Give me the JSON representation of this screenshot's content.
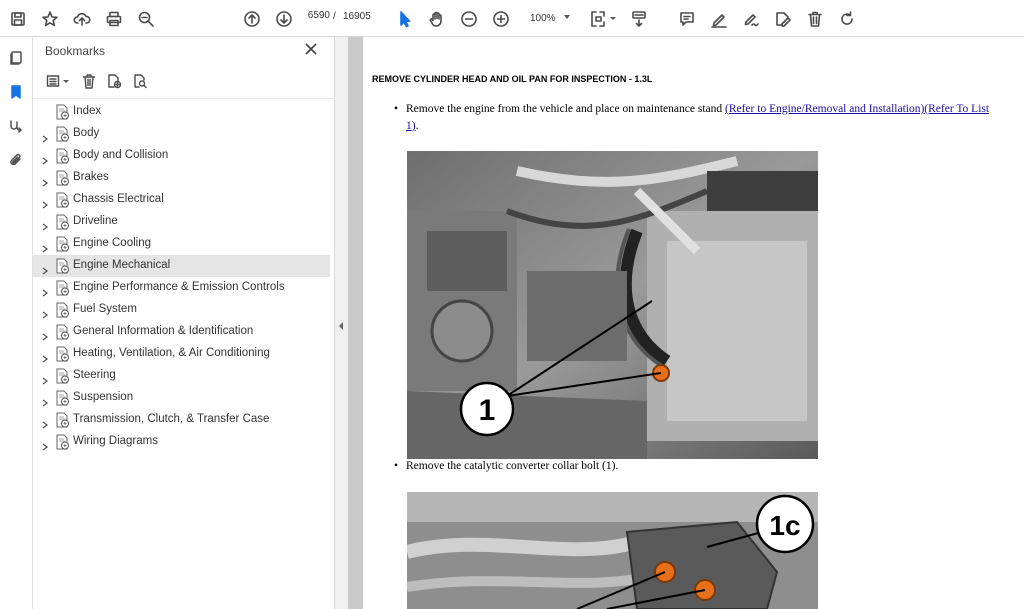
{
  "toolbar": {
    "page_current": "6590",
    "page_separator": "/",
    "page_total": "16905",
    "zoom": "100%"
  },
  "panel": {
    "title": "Bookmarks",
    "items": [
      {
        "label": "Index",
        "expandable": false
      },
      {
        "label": "Body",
        "expandable": true
      },
      {
        "label": "Body and Collision",
        "expandable": true
      },
      {
        "label": "Brakes",
        "expandable": true
      },
      {
        "label": "Chassis Electrical",
        "expandable": true
      },
      {
        "label": "Driveline",
        "expandable": true
      },
      {
        "label": "Engine Cooling",
        "expandable": true
      },
      {
        "label": "Engine Mechanical",
        "expandable": true,
        "selected": true
      },
      {
        "label": "Engine Performance & Emission Controls",
        "expandable": true
      },
      {
        "label": "Fuel System",
        "expandable": true
      },
      {
        "label": "General Information & Identification",
        "expandable": true
      },
      {
        "label": "Heating, Ventilation, & Air Conditioning",
        "expandable": true
      },
      {
        "label": "Steering",
        "expandable": true
      },
      {
        "label": "Suspension",
        "expandable": true
      },
      {
        "label": "Transmission, Clutch, & Transfer Case",
        "expandable": true
      },
      {
        "label": "Wiring Diagrams",
        "expandable": true
      }
    ]
  },
  "document": {
    "heading": "REMOVE CYLINDER HEAD AND OIL PAN FOR INSPECTION - 1.3L",
    "step1_text": "Remove the engine from the vehicle and place on maintenance stand ",
    "step1_link1": "(Refer to Engine/Removal and Installation)",
    "step1_link2": "(Refer To List",
    "step1_link3": "1)",
    "step1_end": ".",
    "step2_text": "Remove the catalytic converter collar bolt (1).",
    "figure1_callout": "1",
    "figure2_callout": "1c",
    "bullet": "•"
  },
  "colors": {
    "accent": "#1473e6",
    "selected_bg": "#e5e5e5",
    "link": "#1a0dab",
    "bolt": "#e8701a"
  }
}
